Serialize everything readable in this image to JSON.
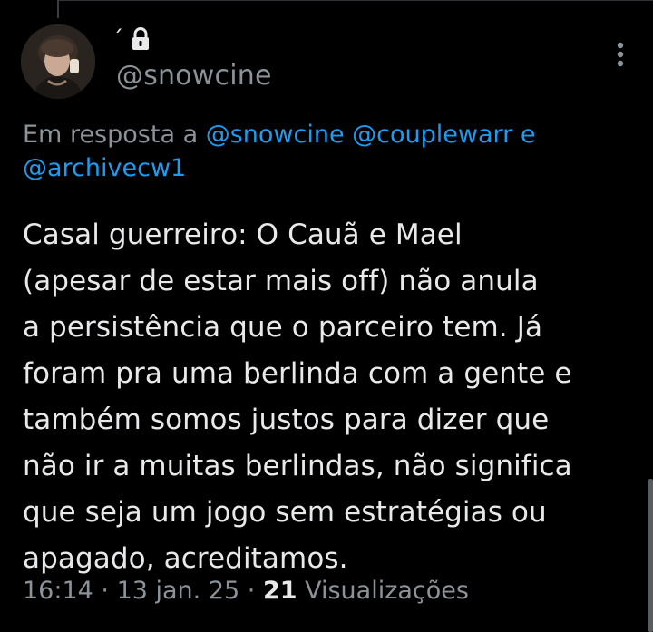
{
  "tweet": {
    "display_name": "´",
    "handle": "@snowcine",
    "reply": {
      "prefix": "Em resposta a ",
      "mentions": [
        "@snowcine",
        "@couplewarr",
        "@archivecw1"
      ],
      "conjunction": " e "
    },
    "text": "Casal guerreiro: O Cauã e Mael\n(apesar de estar mais off) não anula\na persistência que o parceiro tem. Já\nforam pra uma berlinda com a gente e\ntambém somos justos para dizer que\nnão ir a muitas berlindas, não significa\nque seja um jogo sem estratégias ou\napagado, acreditamos.",
    "time": "16:14",
    "separator": " · ",
    "date": "13 jan. 25",
    "views_count": "21",
    "views_label": " Visualizações"
  },
  "icons": {
    "lock": "lock-icon",
    "more": "more-vertical-icon"
  },
  "colors": {
    "background": "#000000",
    "primary_text": "#e7e9ea",
    "secondary_text": "#8b9399",
    "accent": "#1d9bf0"
  }
}
